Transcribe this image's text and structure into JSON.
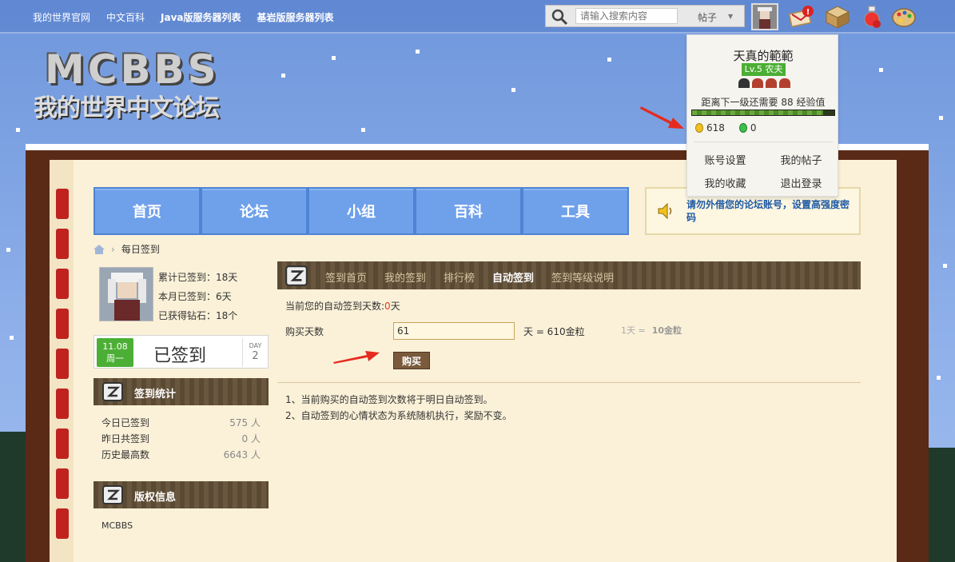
{
  "toplinks": [
    "我的世界官网",
    "中文百科",
    "Java版服务器列表",
    "基岩版服务器列表"
  ],
  "search": {
    "placeholder": "请输入搜索内容",
    "type": "帖子"
  },
  "notification_badge": "!",
  "logo": {
    "main": "MCBBS",
    "sub": "我的世界中文论坛"
  },
  "nav": [
    "首页",
    "论坛",
    "小组",
    "百科",
    "工具"
  ],
  "notice": "请勿外借您的论坛账号，设置高强度密码",
  "breadcrumb": {
    "current": "每日签到"
  },
  "profile": {
    "total_signed": "累计已签到：18天",
    "month_signed": "本月已签到：6天",
    "diamonds": "已获得钻石：18个"
  },
  "signbox": {
    "date": "11.08",
    "weekday": "周一",
    "status": "已签到",
    "day_label": "DAY",
    "day_num": "2"
  },
  "stats": {
    "title": "签到统计",
    "rows": [
      {
        "label": "今日已签到",
        "value": "575 人"
      },
      {
        "label": "昨日共签到",
        "value": "0 人"
      },
      {
        "label": "历史最高数",
        "value": "6643 人"
      }
    ]
  },
  "copyright": {
    "title": "版权信息",
    "text": "MCBBS"
  },
  "tabs": [
    "签到首页",
    "我的签到",
    "排行榜",
    "自动签到",
    "签到等级说明"
  ],
  "active_tab": 3,
  "autosign": {
    "current_prefix": "当前您的自动签到天数:",
    "current_value": "0",
    "current_suffix": "天",
    "buy_label": "购买天数",
    "buy_value": "61",
    "buy_calc": "天 = 610金粒",
    "rate_prefix": "1天 =",
    "rate_value": "10金粒",
    "buy_button": "购买",
    "notes": [
      "1、当前购买的自动签到次数将于明日自动签到。",
      "2、自动签到的心情状态为系统随机执行，奖励不变。"
    ]
  },
  "dropdown": {
    "username": "天真的範範",
    "level": "Lv.5 农夫",
    "exp_text": "距离下一级还需要 88 经验值",
    "exp_progress": 0.92,
    "gold": "618",
    "emerald": "0",
    "links": [
      "账号设置",
      "我的帖子",
      "我的收藏",
      "退出登录"
    ]
  },
  "colors": {
    "accent_green": "#4caf35",
    "nav_blue": "#6fa0ea",
    "notice_blue": "#1f5aa6",
    "red": "#e23a23"
  }
}
